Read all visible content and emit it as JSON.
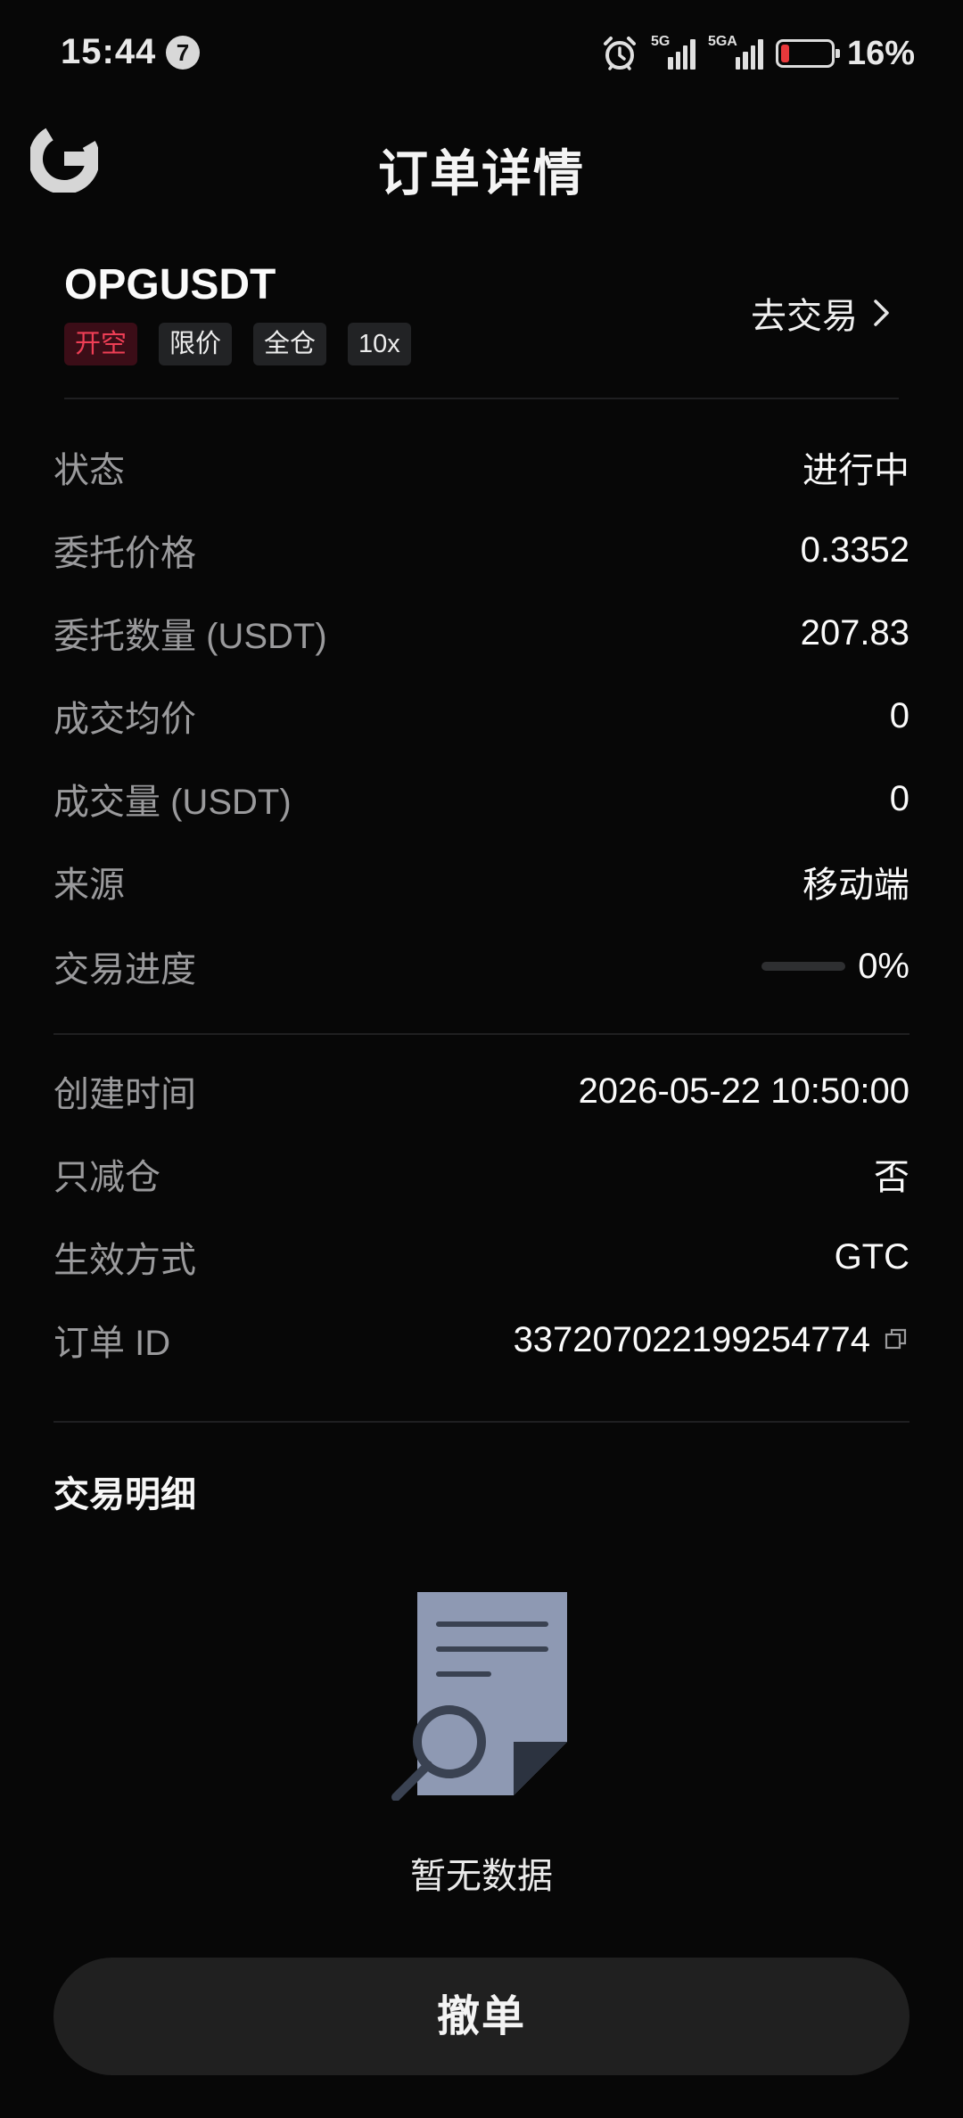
{
  "status_bar": {
    "time": "15:44",
    "notification_count": "7",
    "signal_1_label": "5G",
    "signal_2_label": "5GA",
    "battery_level": 0.16,
    "battery_text": "16%",
    "battery_color": "#e8383b"
  },
  "header": {
    "title": "订单详情",
    "logo_icon": "exchange-logo-icon"
  },
  "order": {
    "symbol": "OPGUSDT",
    "tags": [
      "开空",
      "限价",
      "全仓",
      "10x"
    ],
    "trade_link_label": "去交易",
    "trade_link_icon": "chevron-right-icon"
  },
  "details": [
    {
      "key": "状态",
      "value": "进行中"
    },
    {
      "key": "委托价格",
      "value": "0.3352"
    },
    {
      "key": "委托数量 (USDT)",
      "value": "207.83"
    },
    {
      "key": "成交均价",
      "value": "0"
    },
    {
      "key": "成交量 (USDT)",
      "value": "0"
    },
    {
      "key": "来源",
      "value": "移动端"
    },
    {
      "key": "交易进度",
      "value": "0%",
      "progress": 0
    }
  ],
  "details_2": [
    {
      "key": "创建时间",
      "value": "2026-05-22 10:50:00"
    },
    {
      "key": "只减仓",
      "value": "否"
    },
    {
      "key": "生效方式",
      "value": "GTC"
    },
    {
      "key": "订单 ID",
      "value": "337207022199254774",
      "icon": "copy-icon"
    }
  ],
  "trade_details": {
    "title": "交易明细",
    "empty_text": "暂无数据",
    "empty_icon": "document-search-icon"
  },
  "actions": {
    "cancel_label": "撤单"
  },
  "colors": {
    "background": "#070707",
    "sell_red": "#ee3e55",
    "sell_red_bg": "#3b0d17",
    "muted_text": "#9a9a9c",
    "button_bg": "#202020"
  }
}
